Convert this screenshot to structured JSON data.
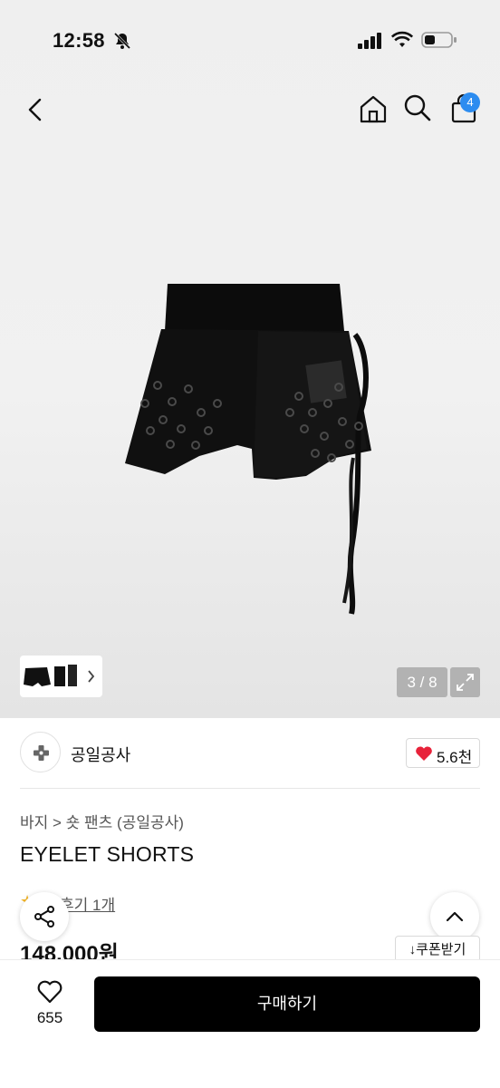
{
  "status_bar": {
    "time": "12:58"
  },
  "header": {
    "cart_count": "4"
  },
  "gallery": {
    "counter": "3 / 8"
  },
  "brand": {
    "name": "공일공사",
    "likes": "5.6천"
  },
  "product": {
    "breadcrumb": "바지 > 숏 팬츠 (공일공사)",
    "title": "EYELET SHORTS",
    "review_link": "후기 1개",
    "price": "148,000원",
    "coupon_label": "↓쿠폰받기"
  },
  "bottom_bar": {
    "wish_count": "655",
    "buy_label": "구매하기"
  },
  "colors": {
    "accent": "#2c8cf0",
    "heart": "#e8223a",
    "star": "#f5b72a",
    "buy_bg": "#000000"
  }
}
